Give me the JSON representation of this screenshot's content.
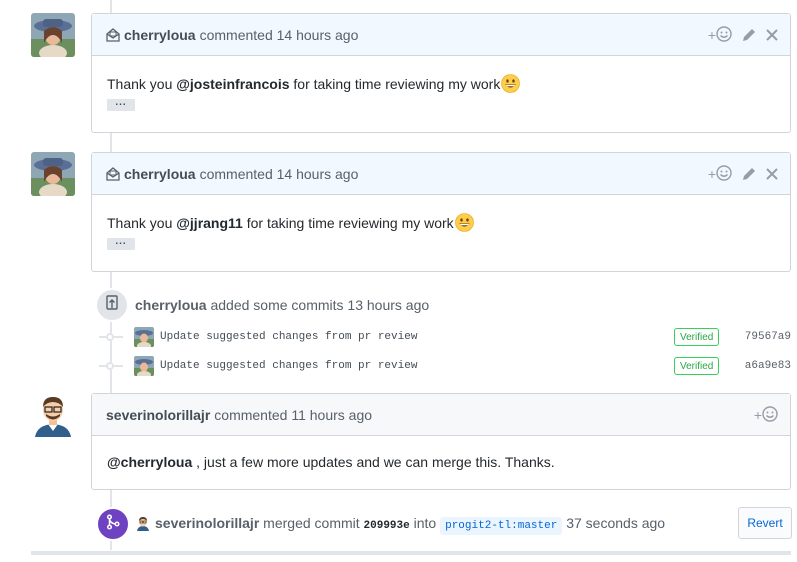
{
  "comments": [
    {
      "author": "cherryloua",
      "verb": "commented",
      "time": "14 hours ago",
      "body_prefix": "Thank you ",
      "mention": "@josteinfrancois",
      "body_suffix": " for taking time reviewing my work",
      "ellipsis": "..."
    },
    {
      "author": "cherryloua",
      "verb": "commented",
      "time": "14 hours ago",
      "body_prefix": "Thank you ",
      "mention": "@jjrang11",
      "body_suffix": " for taking time reviewing my work",
      "ellipsis": "..."
    },
    {
      "author": "severinolorillajr",
      "verb": "commented",
      "time": "11 hours ago",
      "mention": "@cherryloua",
      "body_suffix": " , just a few more updates and we can merge this. Thanks."
    }
  ],
  "commit_event": {
    "author": "cherryloua",
    "text": "added some commits 13 hours ago",
    "commits": [
      {
        "message": "Update suggested changes from pr review",
        "badge": "Verified",
        "sha": "79567a9"
      },
      {
        "message": "Update suggested changes from pr review",
        "badge": "Verified",
        "sha": "a6a9e83"
      }
    ]
  },
  "merge_event": {
    "author": "severinolorillajr",
    "text_merged": "merged commit",
    "commit_sha": "209993e",
    "text_into": "into",
    "branch": "progit2-tl:master",
    "time": "37 seconds ago",
    "revert_label": "Revert"
  },
  "icons": {
    "reaction": "add-reaction-icon",
    "edit": "pencil-icon",
    "close": "close-icon",
    "commit": "repo-push-icon",
    "merge": "git-merge-icon",
    "mail": "mail-read-icon"
  },
  "colors": {
    "merge_badge": "#6f42c1",
    "verified": "#28a745",
    "link": "#0366d6"
  },
  "plus_sign": "+"
}
